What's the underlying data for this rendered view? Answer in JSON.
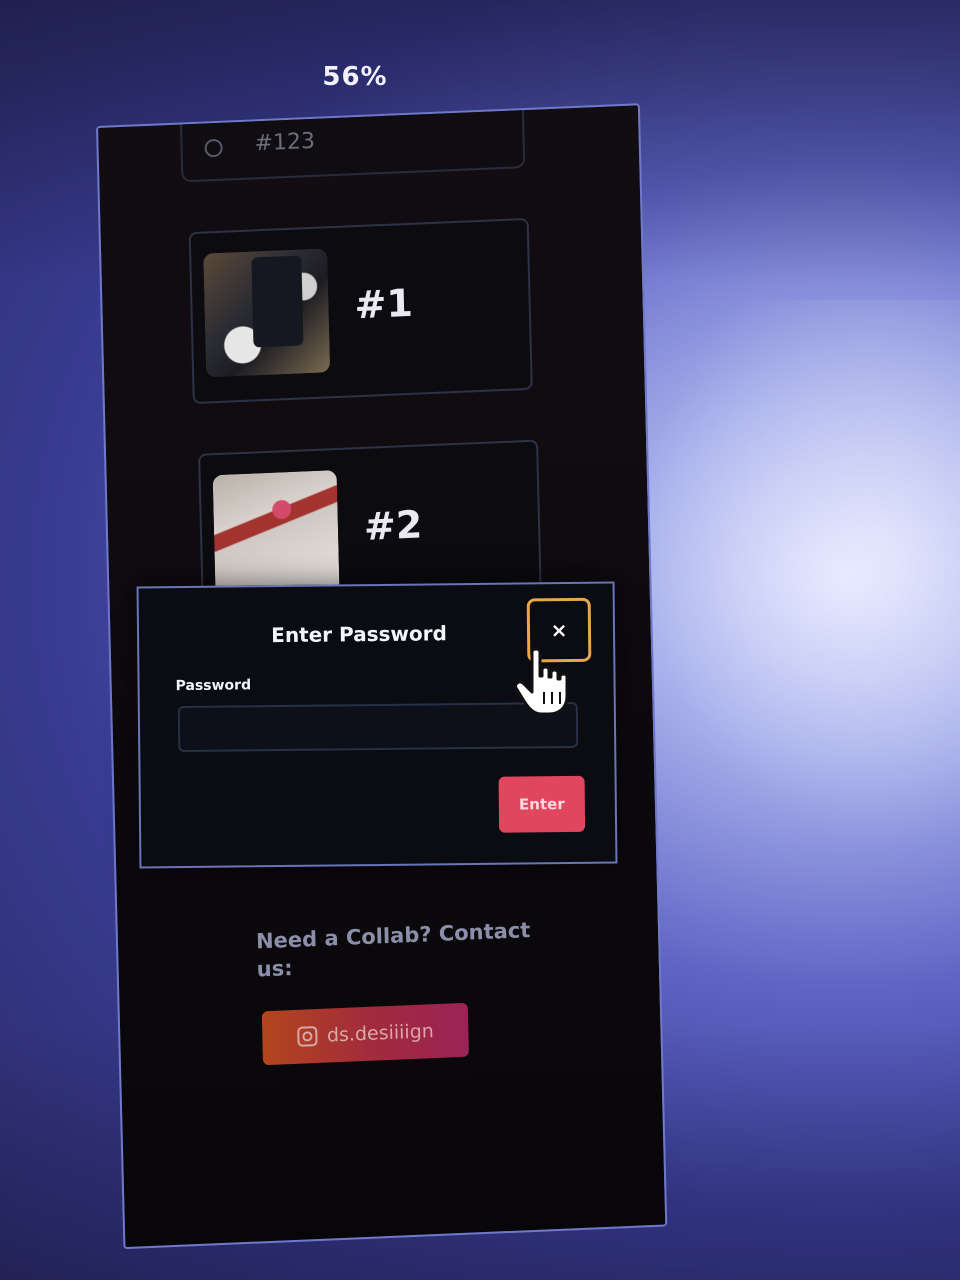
{
  "browser": {
    "zoom_level": "56%"
  },
  "page": {
    "search": {
      "icon": "search-icon",
      "text": "#123"
    },
    "cards": [
      {
        "label": "#1",
        "image": "outfit-thumbnail"
      },
      {
        "label": "#2",
        "image": "outfit-thumbnail"
      }
    ],
    "contact": {
      "heading": "Need a Collab? Contact us:",
      "instagram_handle": "ds.desiiiign",
      "icon": "instagram-icon"
    }
  },
  "modal": {
    "title": "Enter Password",
    "close_label": "×",
    "password_label": "Password",
    "password_value": "",
    "submit_label": "Enter"
  },
  "colors": {
    "accent_button": "#e0475f",
    "close_focus_border": "#e7a64a",
    "modal_border": "#6a74b8",
    "instagram_gradient_start": "#b3451c",
    "instagram_gradient_end": "#9b2356"
  }
}
